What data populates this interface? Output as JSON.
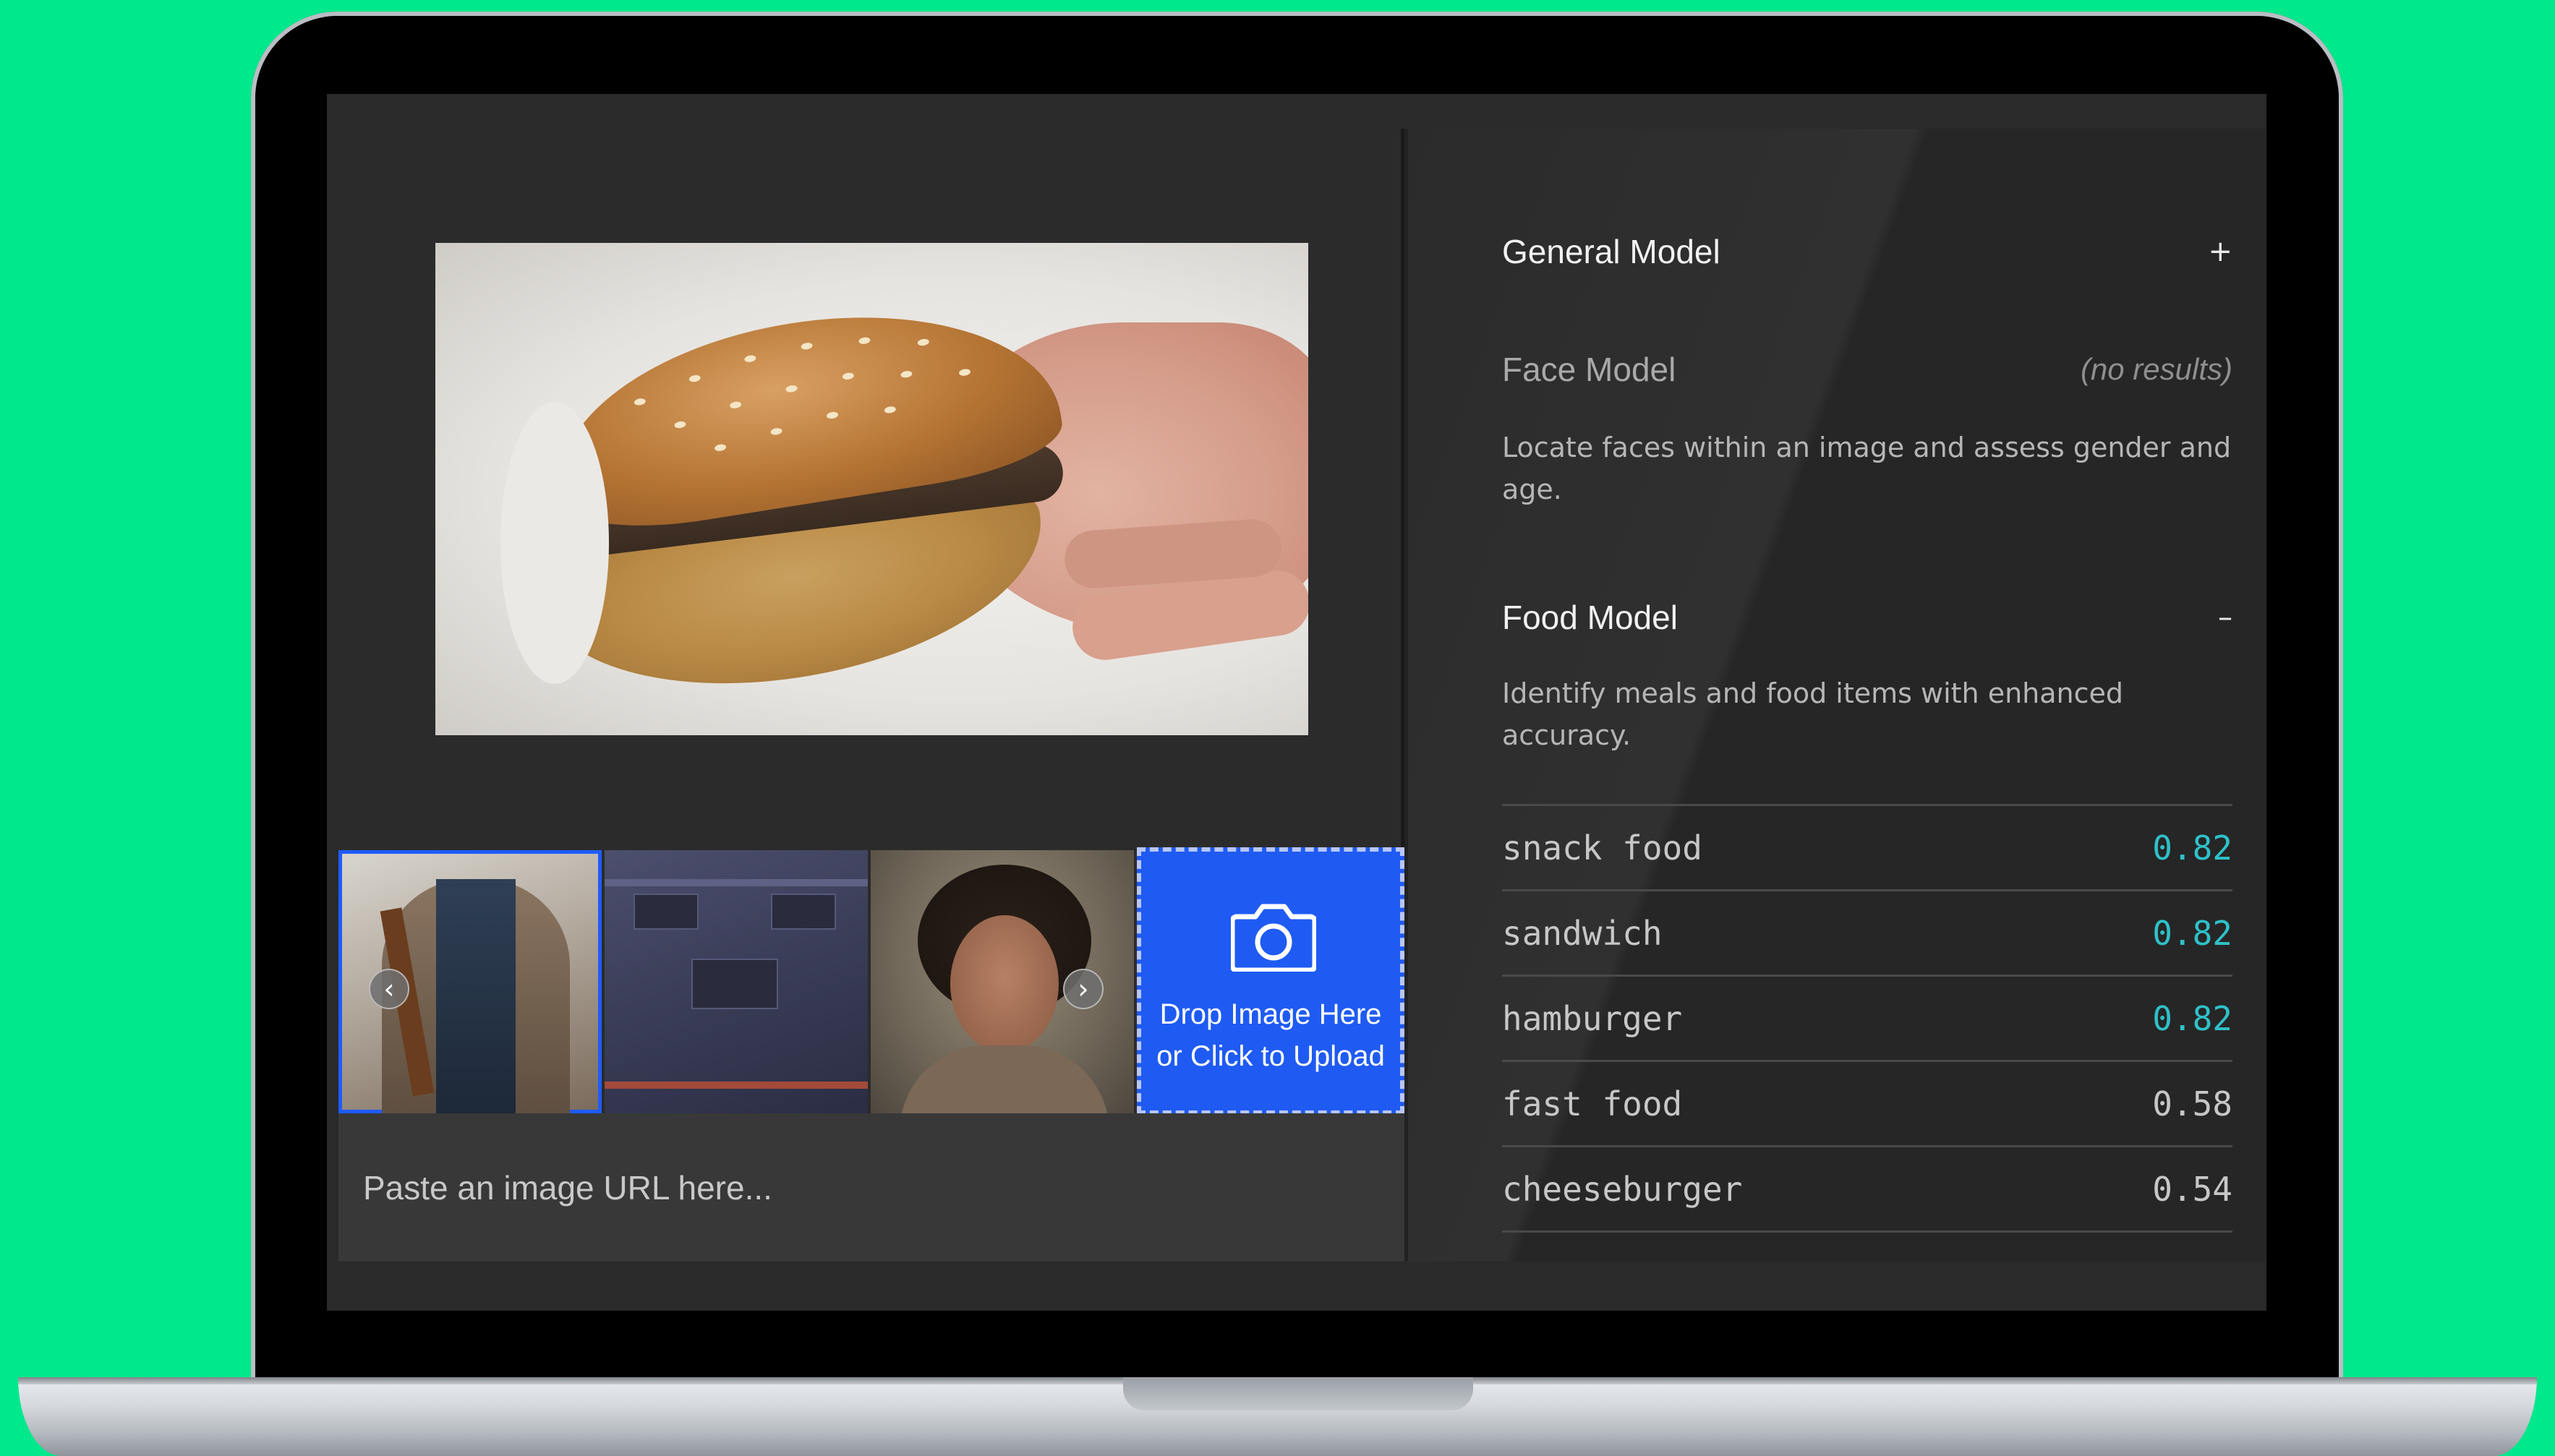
{
  "upload": {
    "line1": "Drop Image Here",
    "line2": "or Click to Upload"
  },
  "url_input": {
    "placeholder": "Paste an image URL here..."
  },
  "models": {
    "general": {
      "title": "General Model",
      "toggle": "+"
    },
    "face": {
      "title": "Face Model",
      "status": "(no results)",
      "description": "Locate faces within an image and assess gender and age."
    },
    "food": {
      "title": "Food Model",
      "toggle": "–",
      "description": "Identify meals and food items with enhanced accuracy."
    }
  },
  "results": [
    {
      "name": "snack food",
      "value": "0.82",
      "highlight": true
    },
    {
      "name": "sandwich",
      "value": "0.82",
      "highlight": true
    },
    {
      "name": "hamburger",
      "value": "0.82",
      "highlight": true
    },
    {
      "name": "fast food",
      "value": "0.58",
      "highlight": false
    },
    {
      "name": "cheeseburger",
      "value": "0.54",
      "highlight": false
    }
  ],
  "colors": {
    "background": "#00e88c",
    "accent_blue": "#1f5bf2",
    "score_highlight": "#2ec1c9"
  },
  "icons": {
    "camera": "camera-icon",
    "prev": "chevron-left-icon",
    "next": "chevron-right-icon"
  }
}
